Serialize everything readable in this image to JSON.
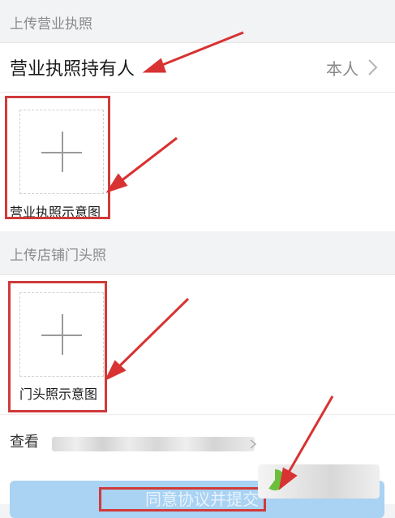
{
  "license_section": {
    "header": "上传营业执照",
    "holder_label": "营业执照持有人",
    "holder_value": "本人",
    "sample_caption": "营业执照示意图"
  },
  "storefront_section": {
    "header": "上传店铺门头照",
    "sample_caption": "门头照示意图"
  },
  "footer": {
    "view_label": "查看",
    "submit_label": "同意协议并提交"
  },
  "colors": {
    "accent_red": "#d03a3a",
    "button_blue": "#a9d2f3",
    "background_gray": "#f2f3f5"
  },
  "icons": [
    "chevron-right-icon",
    "plus-icon",
    "loading-icon",
    "annotation-arrow-icon"
  ]
}
